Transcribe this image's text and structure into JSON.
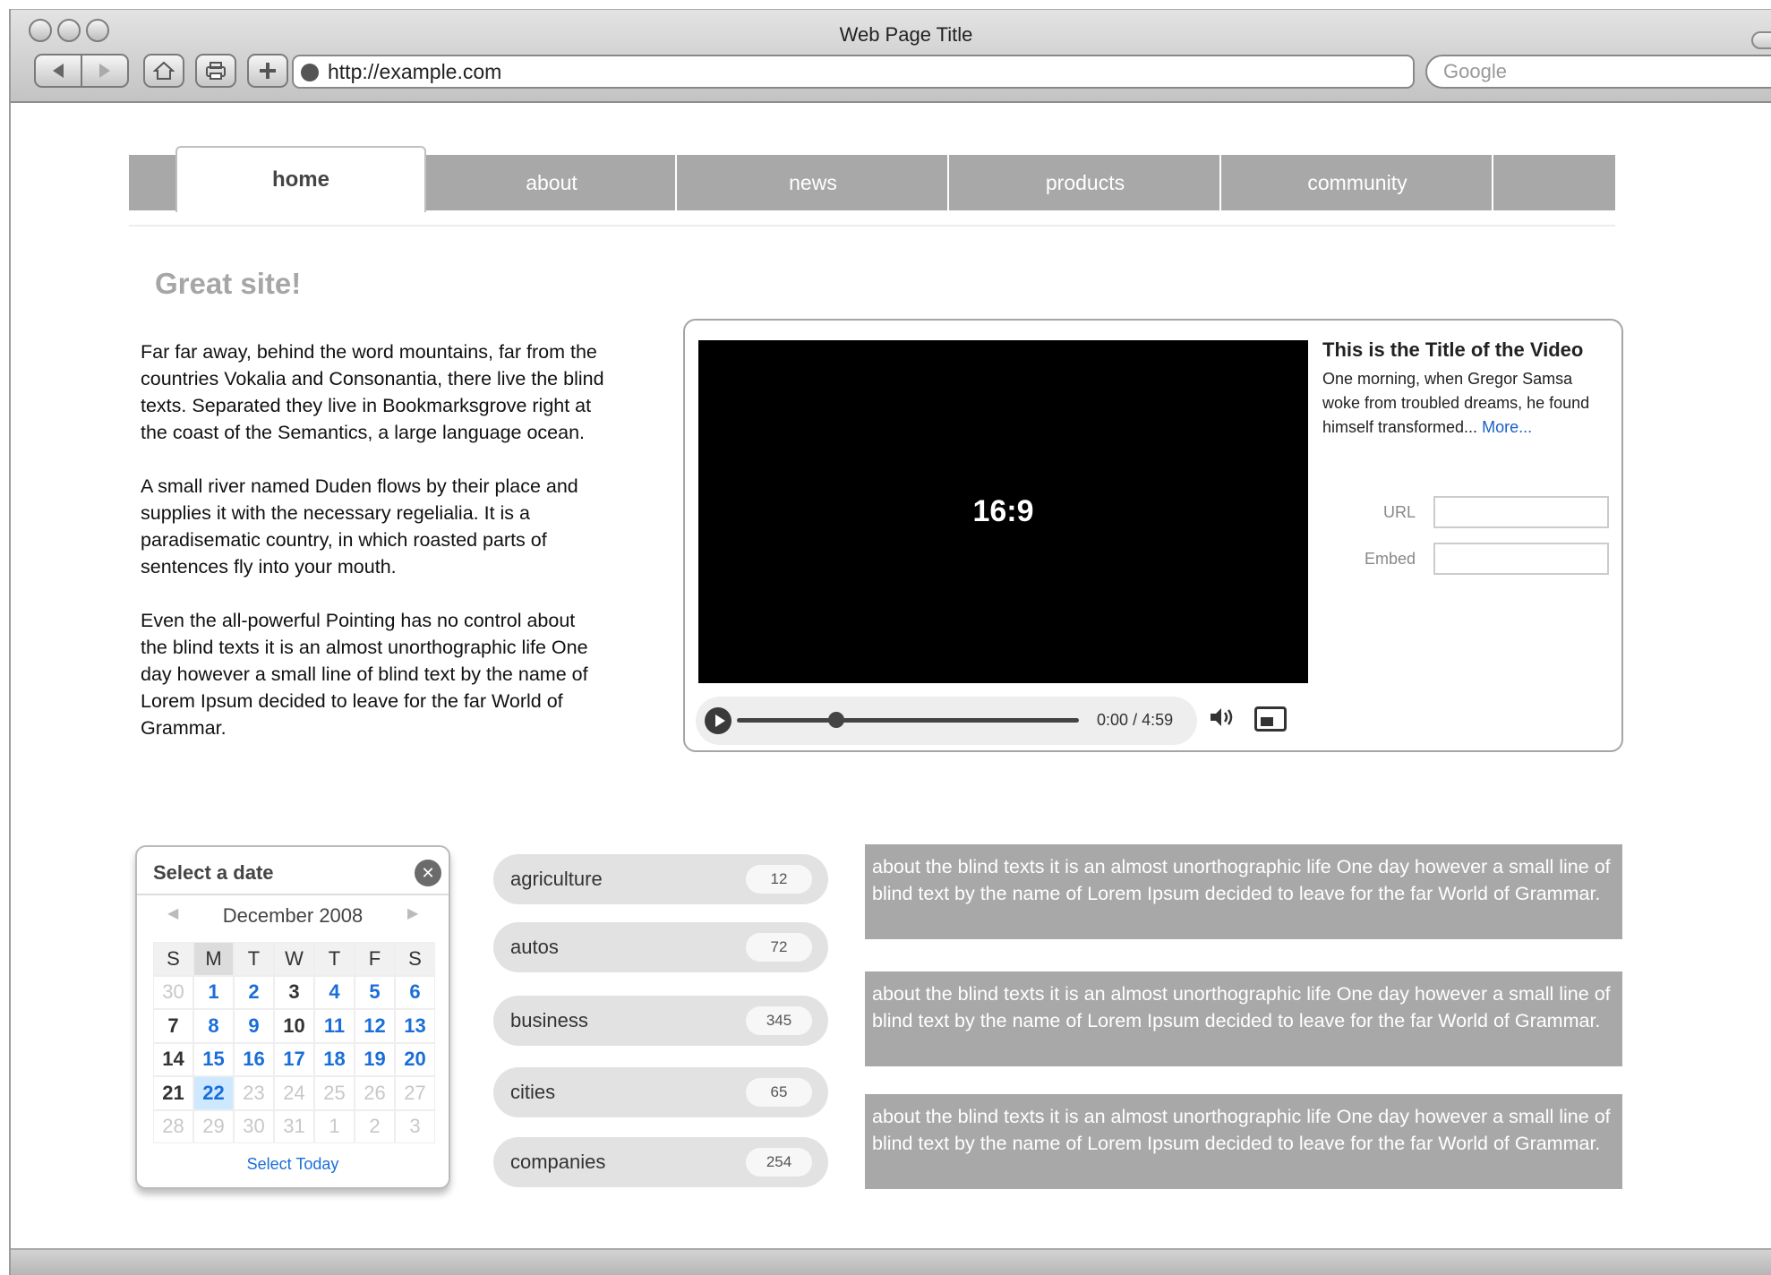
{
  "browser": {
    "window_title": "Web Page Title",
    "url": "http://example.com",
    "search_placeholder": "Google"
  },
  "nav": {
    "tabs": [
      {
        "label": "home",
        "active": true
      },
      {
        "label": "about",
        "active": false
      },
      {
        "label": "news",
        "active": false
      },
      {
        "label": "products",
        "active": false
      },
      {
        "label": "community",
        "active": false
      }
    ]
  },
  "content": {
    "heading": "Great site!",
    "paragraphs": [
      "Far far away, behind the word mountains, far from the countries Vokalia and Consonantia, there live the blind texts. Separated they live in Bookmarksgrove right at the coast of the Semantics, a large language ocean.",
      "A small river named Duden flows by their place and supplies it with the necessary regelialia. It is a paradisematic country, in which roasted parts of sentences fly into your mouth.",
      "Even the all-powerful Pointing has no control about the blind texts it is an almost unorthographic life One day however a small line of blind text by the name of Lorem Ipsum decided to leave for the far World of Grammar."
    ]
  },
  "video": {
    "aspect_label": "16:9",
    "title": "This is the Title of the Video",
    "description": "One morning, when Gregor Samsa woke from troubled dreams, he found himself transformed...",
    "more_link": "More...",
    "current_time": "0:00",
    "time_separator": "/",
    "duration": "4:59",
    "progress_fraction": 0.29,
    "url_label": "URL",
    "embed_label": "Embed",
    "icons": {
      "play": "play-icon",
      "volume": "volume-icon",
      "fullscreen": "fullscreen-icon"
    }
  },
  "calendar": {
    "header": "Select a date",
    "month": "December 2008",
    "prev_glyph": "◀",
    "next_glyph": "▶",
    "close_glyph": "✕",
    "weekdays": [
      "S",
      "M",
      "T",
      "W",
      "T",
      "F",
      "S"
    ],
    "weeks": [
      [
        {
          "d": "30",
          "s": "muted"
        },
        {
          "d": "1",
          "s": "link"
        },
        {
          "d": "2",
          "s": "link"
        },
        {
          "d": "3",
          "s": "plain"
        },
        {
          "d": "4",
          "s": "link"
        },
        {
          "d": "5",
          "s": "link"
        },
        {
          "d": "6",
          "s": "link"
        }
      ],
      [
        {
          "d": "7",
          "s": "plain"
        },
        {
          "d": "8",
          "s": "link"
        },
        {
          "d": "9",
          "s": "link"
        },
        {
          "d": "10",
          "s": "plain"
        },
        {
          "d": "11",
          "s": "link"
        },
        {
          "d": "12",
          "s": "link"
        },
        {
          "d": "13",
          "s": "link"
        }
      ],
      [
        {
          "d": "14",
          "s": "plain"
        },
        {
          "d": "15",
          "s": "link"
        },
        {
          "d": "16",
          "s": "link"
        },
        {
          "d": "17",
          "s": "link"
        },
        {
          "d": "18",
          "s": "link"
        },
        {
          "d": "19",
          "s": "link"
        },
        {
          "d": "20",
          "s": "link"
        }
      ],
      [
        {
          "d": "21",
          "s": "plain"
        },
        {
          "d": "22",
          "s": "today"
        },
        {
          "d": "23",
          "s": "muted"
        },
        {
          "d": "24",
          "s": "muted"
        },
        {
          "d": "25",
          "s": "muted"
        },
        {
          "d": "26",
          "s": "muted"
        },
        {
          "d": "27",
          "s": "muted"
        }
      ],
      [
        {
          "d": "28",
          "s": "muted"
        },
        {
          "d": "29",
          "s": "muted"
        },
        {
          "d": "30",
          "s": "muted"
        },
        {
          "d": "31",
          "s": "muted"
        },
        {
          "d": "1",
          "s": "muted"
        },
        {
          "d": "2",
          "s": "muted"
        },
        {
          "d": "3",
          "s": "muted"
        }
      ]
    ],
    "select_today": "Select Today"
  },
  "tags": [
    {
      "label": "agriculture",
      "count": "12"
    },
    {
      "label": "autos",
      "count": "72"
    },
    {
      "label": "business",
      "count": "345"
    },
    {
      "label": "cities",
      "count": "65"
    },
    {
      "label": "companies",
      "count": "254"
    }
  ],
  "blocks": [
    "about the blind texts it is an almost unorthographic life One day however a small line of blind text by the name of Lorem Ipsum decided to leave for the far World of Grammar.",
    "about the blind texts it is an almost unorthographic life One day however a small line of blind text by the name of Lorem Ipsum decided to leave for the far World of Grammar.",
    "about the blind texts it is an almost unorthographic life One day however a small line of blind text by the name of Lorem Ipsum decided to leave for the far World of Grammar."
  ],
  "colors": {
    "accent_link": "#1a6ed8",
    "tab_gray": "#a8a8a8",
    "today_bg": "#cde8ff"
  }
}
